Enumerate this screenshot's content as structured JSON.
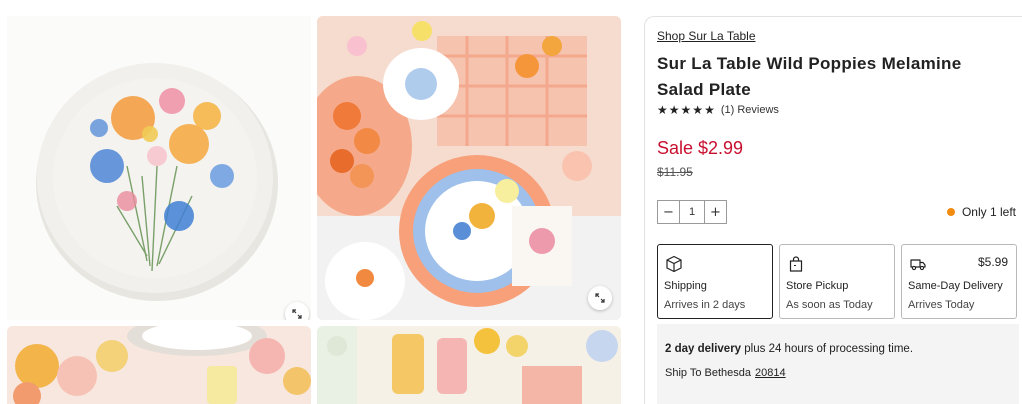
{
  "product": {
    "brand_link": "Shop Sur La Table",
    "title": "Sur La Table Wild Poppies Melamine Salad Plate",
    "rating": 5,
    "reviews_label": "(1) Reviews",
    "sale_price": "Sale $2.99",
    "original_price": "$11.95",
    "quantity": "1",
    "stock_text": "Only 1 left"
  },
  "fulfillment": {
    "shipping": {
      "name": "Shipping",
      "sub": "Arrives in 2 days",
      "icon": "box-icon",
      "selected": true
    },
    "pickup": {
      "name": "Store Pickup",
      "sub": "As soon as Today",
      "icon": "shopping-bag-icon"
    },
    "same_day": {
      "name": "Same-Day Delivery",
      "sub": "Arrives Today",
      "price": "$5.99",
      "icon": "delivery-truck-icon"
    }
  },
  "delivery": {
    "bold": "2 day delivery",
    "rest": " plus 24 hours of processing time.",
    "ship_to_label": "Ship To Bethesda",
    "zip": "20814"
  },
  "colors": {
    "sale": "#c8102e",
    "stock_dot": "#f28c0f"
  }
}
